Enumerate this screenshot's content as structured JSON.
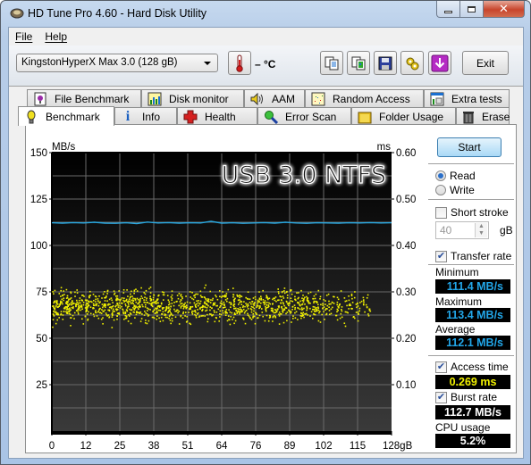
{
  "window": {
    "title": "HD Tune Pro 4.60 - Hard Disk Utility",
    "controls": [
      "minimize",
      "maximize",
      "close"
    ]
  },
  "menu": [
    {
      "label": "File",
      "accel": "F"
    },
    {
      "label": "Help",
      "accel": "H"
    }
  ],
  "toolbar": {
    "drive": "KingstonHyperX Max 3.0 (128 gB)",
    "temperature": "– °C",
    "icons": [
      "copy-text-icon",
      "copy-screenshot-icon",
      "save-icon",
      "options-icon",
      "download-icon"
    ],
    "exit_label": "Exit"
  },
  "tabs_top": [
    {
      "label": "File Benchmark",
      "icon": "file-benchmark-icon"
    },
    {
      "label": "Disk monitor",
      "icon": "disk-monitor-icon"
    },
    {
      "label": "AAM",
      "icon": "speaker-icon"
    },
    {
      "label": "Random Access",
      "icon": "random-access-icon"
    },
    {
      "label": "Extra tests",
      "icon": "extra-tests-icon"
    }
  ],
  "tabs_bottom": [
    {
      "label": "Benchmark",
      "icon": "lightbulb-icon",
      "active": true
    },
    {
      "label": "Info",
      "icon": "info-icon"
    },
    {
      "label": "Health",
      "icon": "health-cross-icon"
    },
    {
      "label": "Error Scan",
      "icon": "magnifier-icon"
    },
    {
      "label": "Folder Usage",
      "icon": "folder-icon"
    },
    {
      "label": "Erase",
      "icon": "trash-icon"
    }
  ],
  "side": {
    "start_label": "Start",
    "read_label": "Read",
    "write_label": "Write",
    "mode": "Read",
    "short_stroke_label": "Short stroke",
    "short_stroke_checked": false,
    "short_stroke_value": "40",
    "short_stroke_unit": "gB",
    "transfer_rate_label": "Transfer rate",
    "transfer_rate_checked": true,
    "minimum_label": "Minimum",
    "minimum_value": "111.4 MB/s",
    "maximum_label": "Maximum",
    "maximum_value": "113.4 MB/s",
    "average_label": "Average",
    "average_value": "112.1 MB/s",
    "access_time_label": "Access time",
    "access_time_checked": true,
    "access_time_value": "0.269 ms",
    "burst_rate_label": "Burst rate",
    "burst_rate_checked": true,
    "burst_rate_value": "112.7 MB/s",
    "cpu_label": "CPU usage",
    "cpu_value": "5.2%"
  },
  "chart_data": {
    "type": "line",
    "title": "USB 3.0 NTFS",
    "xlabel": "gB",
    "ylabel_left": "MB/s",
    "ylabel_right": "ms",
    "x_ticks": [
      "0",
      "12",
      "25",
      "38",
      "51",
      "64",
      "76",
      "89",
      "102",
      "115",
      "128gB"
    ],
    "xlim": [
      0,
      128
    ],
    "y_left_ticks": [
      "150",
      "125",
      "100",
      "75",
      "50",
      "25"
    ],
    "ylim_left": [
      0,
      150
    ],
    "y_right_ticks": [
      "0.60",
      "0.50",
      "0.40",
      "0.30",
      "0.20",
      "0.10"
    ],
    "ylim_right": [
      0,
      0.6
    ],
    "grid": true,
    "series": [
      {
        "name": "Transfer rate",
        "axis": "left",
        "color": "#2aa8e0",
        "min": 111.4,
        "max": 113.4,
        "avg": 112.1,
        "x": [
          0,
          4,
          8,
          12,
          16,
          20,
          24,
          28,
          32,
          36,
          40,
          44,
          48,
          52,
          56,
          60,
          64,
          68,
          72,
          76,
          80,
          84,
          88,
          92,
          96,
          100,
          104,
          108,
          112,
          116,
          120,
          124,
          128
        ],
        "y": [
          112.2,
          112.0,
          112.3,
          112.1,
          112.5,
          112.0,
          111.9,
          112.2,
          111.8,
          112.6,
          112.1,
          112.3,
          112.0,
          112.2,
          112.1,
          113.0,
          112.0,
          112.2,
          111.9,
          112.1,
          112.3,
          112.0,
          112.5,
          112.1,
          111.9,
          112.2,
          112.1,
          112.0,
          112.2,
          112.1,
          112.3,
          112.1,
          112.2
        ]
      },
      {
        "name": "Access time",
        "axis": "right",
        "type": "scatter",
        "color": "#f0f000",
        "mean": 0.269,
        "range": [
          0.22,
          0.32
        ],
        "x_range": [
          0,
          120
        ]
      }
    ]
  }
}
